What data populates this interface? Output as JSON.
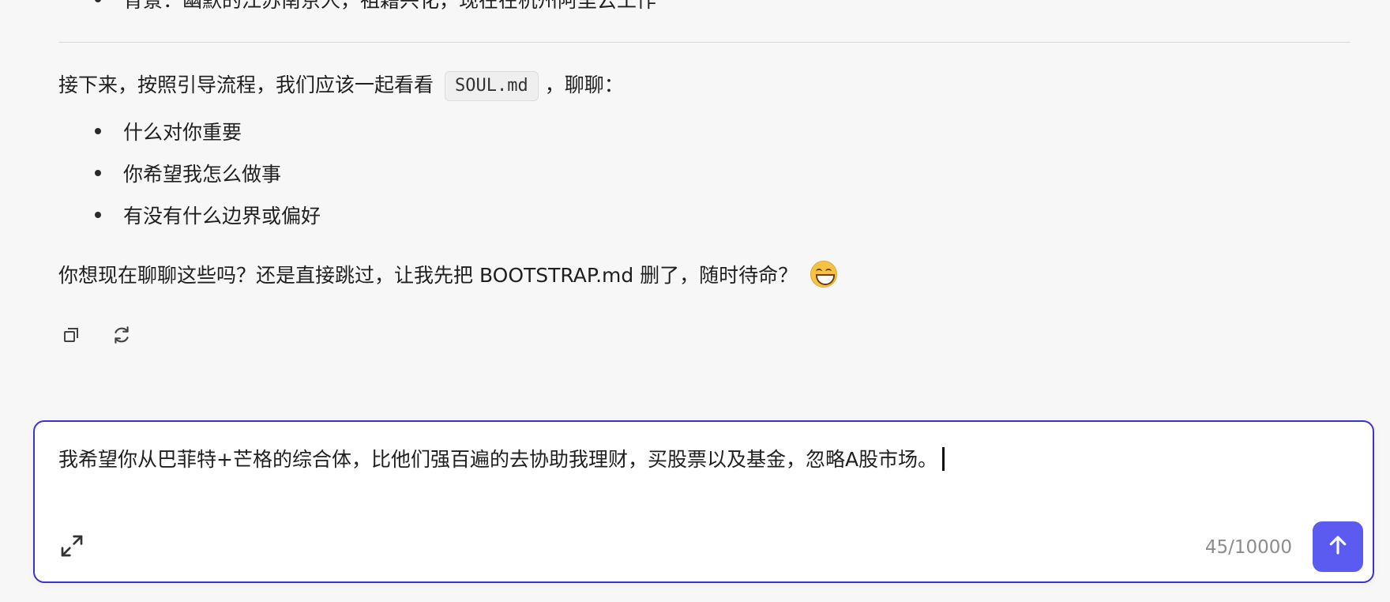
{
  "messages": {
    "top_bullet": "背景：幽默的江苏南京人，祖籍兴化，现在在杭州阿里云工作",
    "intro_before": "接下来，按照引导流程，我们应该一起看看",
    "intro_code": "SOUL.md",
    "intro_after": "，聊聊：",
    "bullets": [
      "什么对你重要",
      "你希望我怎么做事",
      "有没有什么边界或偏好"
    ],
    "question": "你想现在聊聊这些吗？还是直接跳过，让我先把 BOOTSTRAP.md 删了，随时待命？"
  },
  "actions": {
    "copy_icon": "copy-icon",
    "regenerate_icon": "refresh-icon"
  },
  "composer": {
    "value": "我希望你从巴菲特+芒格的综合体，比他们强百遍的去协助我理财，买股票以及基金，忽略A股市场。",
    "counter": "45/10000",
    "expand_icon": "expand-icon",
    "send_icon": "arrow-up-icon",
    "accent_color": "#5b5bf2",
    "border_color": "#3b33d1"
  }
}
